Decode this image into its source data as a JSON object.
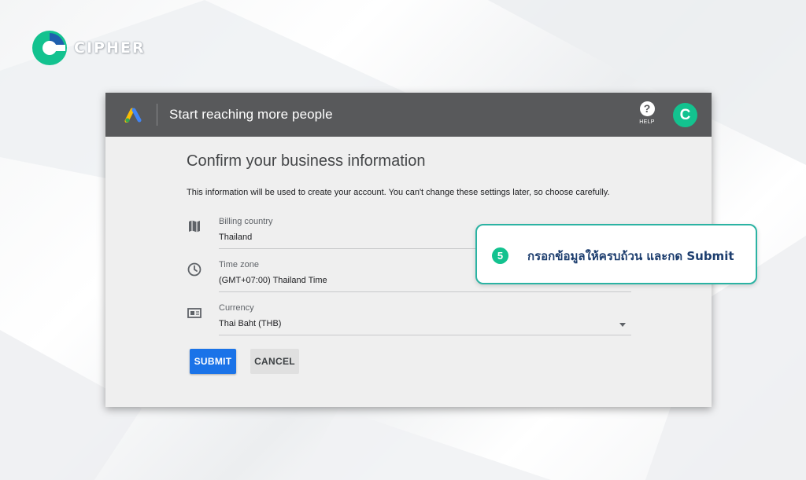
{
  "brand": {
    "name": "CIPHER",
    "accent": "#13c28f"
  },
  "app": {
    "title": "Start reaching more people",
    "help_label": "HELP",
    "avatar_letter": "C"
  },
  "form": {
    "heading": "Confirm your business information",
    "intro": "This information will be used to create your account. You can't change these settings later, so choose carefully.",
    "fields": [
      {
        "icon": "map-icon",
        "label": "Billing country",
        "value": "Thailand"
      },
      {
        "icon": "clock-icon",
        "label": "Time zone",
        "value": "(GMT+07:00) Thailand Time"
      },
      {
        "icon": "currency-icon",
        "label": "Currency",
        "value": "Thai Baht (THB)"
      }
    ],
    "submit_label": "SUBMIT",
    "cancel_label": "CANCEL"
  },
  "callout": {
    "step": "5",
    "text": "กรอกข้อมูลให้ครบถ้วน และกด Submit"
  },
  "colors": {
    "topbar": "#58595b",
    "submit": "#1a73e8",
    "callout_border": "#2bb3a3"
  }
}
